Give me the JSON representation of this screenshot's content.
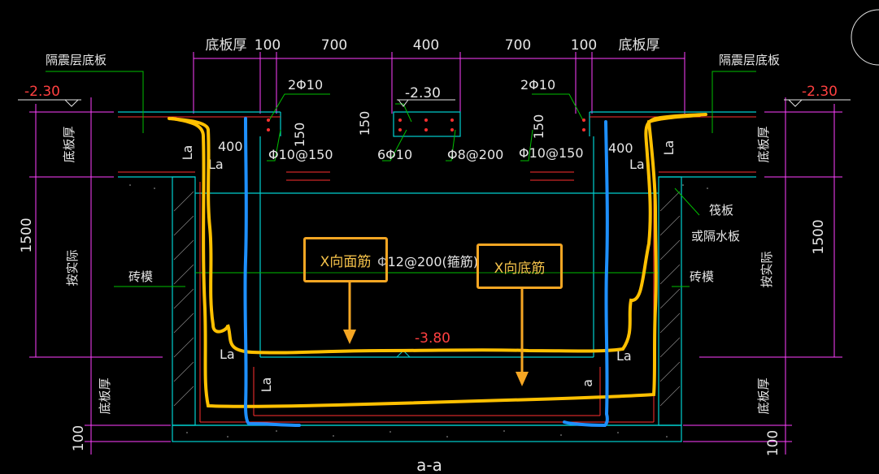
{
  "dims_top": [
    "底板厚",
    "100",
    "700",
    "400",
    "700",
    "100",
    "底板厚"
  ],
  "labels": {
    "isolation_slab": "隔震层底板",
    "elev_top": "-2.30",
    "elev_bottom": "-3.80",
    "bar_2phi10": "2Φ10",
    "dim_150": "150",
    "dim_400": "400",
    "la": "La",
    "la_short": "a",
    "stirrup_phi10": "Φ10@150",
    "bar_6phi10": "6Φ10",
    "bar_phi8": "Φ8@200",
    "slab_thickness": "底板厚",
    "dim_1500": "1500",
    "per_design": "按实际",
    "brick_mold": "砖模",
    "raft": "筏板",
    "or_waterproof": "或隔水板",
    "stirrup_center": "Φ12@200(箍筋)",
    "dim_100": "100",
    "section": "a-a"
  },
  "callouts": {
    "x_top_bar": "X向面筋",
    "x_bottom_bar": "X向底筋"
  },
  "colors": {
    "yellow": "#ffc000",
    "blue": "#1e90ff",
    "orange_box": "#f5a623",
    "magenta": "#ff40ff",
    "cyan": "#00d0d0",
    "red": "#ff3030",
    "green": "#00c000"
  }
}
